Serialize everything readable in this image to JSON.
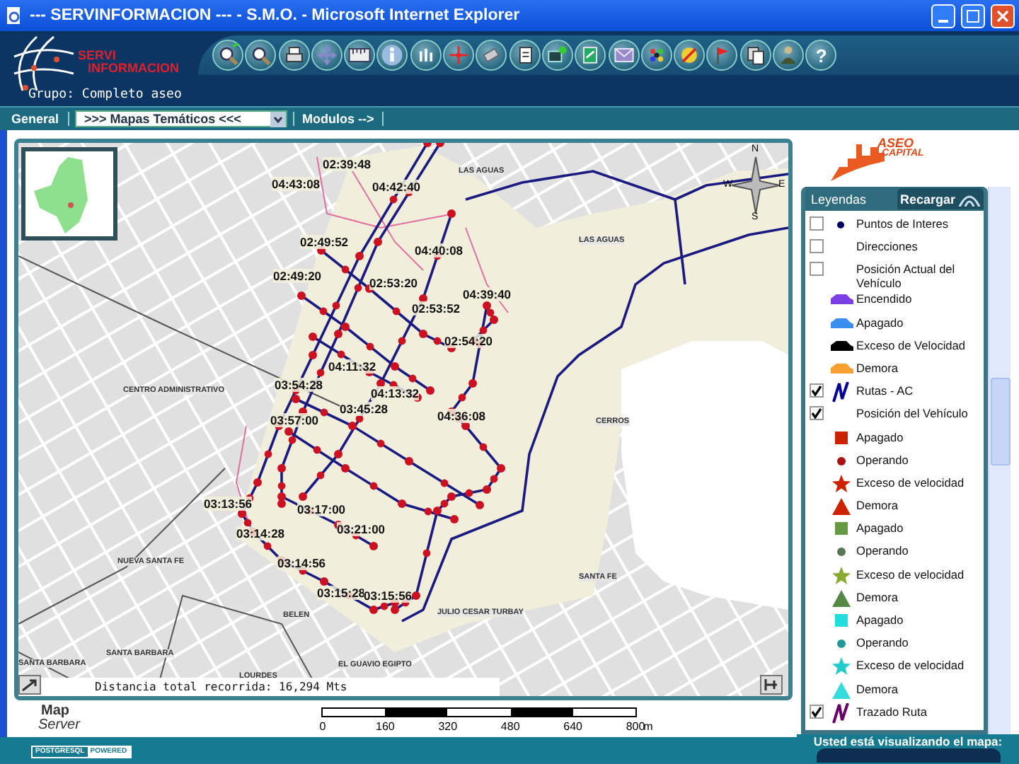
{
  "window": {
    "title": "--- SERVINFORMACION --- - S.M.O. - Microsoft Internet Explorer"
  },
  "header": {
    "logo_line1": "SERVI",
    "logo_line2": "INFORMACION",
    "group": "Grupo: Completo aseo",
    "help_label": "?"
  },
  "nav": {
    "section": "General",
    "select": ">>> Mapas Temáticos <<<",
    "modules": "Modulos -->"
  },
  "map": {
    "time_labels": [
      "02:39:48",
      "04:43:08",
      "04:42:40",
      "02:49:52",
      "04:40:08",
      "02:49:20",
      "02:53:20",
      "04:39:40",
      "02:53:52",
      "02:54:20",
      "04:11:32",
      "03:54:28",
      "04:13:32",
      "03:45:28",
      "04:36:08",
      "03:57:00",
      "03:13:56",
      "03:17:00",
      "03:21:00",
      "03:14:28",
      "03:14:56",
      "03:15:28",
      "03:15:56"
    ],
    "area_labels": [
      "LAS AGUAS",
      "LAS AGUAS",
      "CENTRO ADMINISTRATIVO",
      "CERROS",
      "NUEVA SANTA FE",
      "SANTA FE",
      "BELEN",
      "JULIO CESAR TURBAY",
      "SANTA BARBARA",
      "SANTA BARBARA",
      "EL GUAVIO EGIPTO",
      "LOURDES"
    ],
    "compass": {
      "n": "N",
      "e": "E",
      "s": "S",
      "w": "W"
    },
    "distance": "Distancia total recorrida: 16,294 Mts"
  },
  "scale": {
    "labels": [
      "0",
      "160",
      "320",
      "480",
      "640",
      "800"
    ],
    "unit": "m"
  },
  "mapserver": {
    "line1": "Map",
    "line2": "Server"
  },
  "brand": {
    "line1": "ASEO",
    "line2": "CAPITAL"
  },
  "legend": {
    "tab": "Leyendas",
    "reload": "Recargar",
    "items": [
      {
        "kind": "check-dot",
        "checked": false,
        "color": "#000066",
        "label": "Puntos de Interes"
      },
      {
        "kind": "check",
        "checked": false,
        "label": "Direcciones"
      },
      {
        "kind": "check",
        "checked": false,
        "label": "Posición Actual del Vehículo"
      },
      {
        "kind": "car",
        "color": "#7b3fe4",
        "label": "Encendido"
      },
      {
        "kind": "car",
        "color": "#3a8ef0",
        "label": "Apagado"
      },
      {
        "kind": "car",
        "color": "#000000",
        "label": "Exceso de Velocidad"
      },
      {
        "kind": "car",
        "color": "#f5a030",
        "label": "Demora"
      },
      {
        "kind": "check-route",
        "checked": true,
        "color": "#000099",
        "label": "Rutas - AC"
      },
      {
        "kind": "check",
        "checked": true,
        "label": "Posición del Vehículo"
      },
      {
        "kind": "square",
        "color": "#cc2200",
        "label": "Apagado"
      },
      {
        "kind": "circle",
        "color": "#aa1111",
        "label": "Operando"
      },
      {
        "kind": "star",
        "color": "#cc2200",
        "label": "Exceso de velocidad"
      },
      {
        "kind": "triangle",
        "color": "#cc2200",
        "label": "Demora"
      },
      {
        "kind": "square",
        "color": "#669944",
        "label": "Apagado"
      },
      {
        "kind": "circle",
        "color": "#557755",
        "label": "Operando"
      },
      {
        "kind": "star",
        "color": "#88aa33",
        "label": "Exceso de velocidad"
      },
      {
        "kind": "triangle",
        "color": "#558844",
        "label": "Demora"
      },
      {
        "kind": "square",
        "color": "#22dddd",
        "label": "Apagado"
      },
      {
        "kind": "circle",
        "color": "#229999",
        "label": "Operando"
      },
      {
        "kind": "star",
        "color": "#22cccc",
        "label": "Exceso de velocidad"
      },
      {
        "kind": "triangle",
        "color": "#33dddd",
        "label": "Demora"
      },
      {
        "kind": "check-route",
        "checked": true,
        "color": "#660066",
        "label": "Trazado Ruta"
      }
    ]
  },
  "footer": {
    "badge_line1": "POSTGRESQL",
    "badge_line2": "POWERED",
    "viewing": "Usted está visualizando el mapa:"
  }
}
